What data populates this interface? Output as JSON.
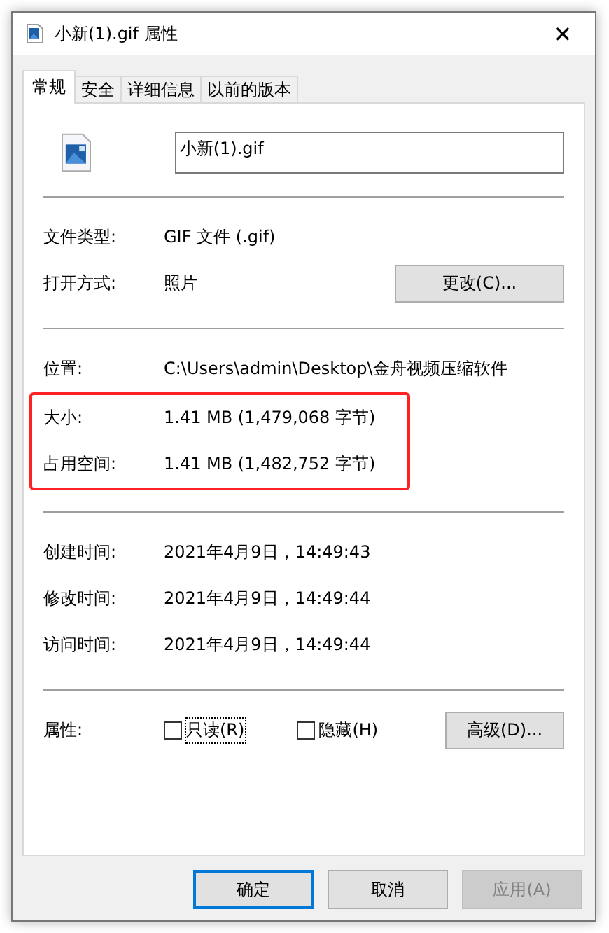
{
  "window": {
    "title": "小新(1).gif 属性",
    "close": "✕"
  },
  "tabs": [
    {
      "label": "常规",
      "selected": true
    },
    {
      "label": "安全",
      "selected": false
    },
    {
      "label": "详细信息",
      "selected": false
    },
    {
      "label": "以前的版本",
      "selected": false
    }
  ],
  "file_name": "小新(1).gif",
  "blocks": [
    {
      "kind": "divider"
    },
    {
      "kind": "row",
      "label": "文件类型:",
      "value": "GIF 文件 (.gif)"
    },
    {
      "kind": "row",
      "label": "打开方式:",
      "value": "照片",
      "button": "更改(C)..."
    },
    {
      "kind": "divider"
    },
    {
      "kind": "row",
      "label": "位置:",
      "value": "C:\\Users\\admin\\Desktop\\金舟视频压缩软件"
    },
    {
      "kind": "highlight",
      "rows": [
        {
          "label": "大小:",
          "value": "1.41 MB (1,479,068 字节)"
        },
        {
          "label": "占用空间:",
          "value": "1.41 MB (1,482,752 字节)"
        }
      ]
    },
    {
      "kind": "divider"
    },
    {
      "kind": "row",
      "label": "创建时间:",
      "value": "2021年4月9日，14:49:43"
    },
    {
      "kind": "row",
      "label": "修改时间:",
      "value": "2021年4月9日，14:49:44"
    },
    {
      "kind": "row",
      "label": "访问时间:",
      "value": "2021年4月9日，14:49:44"
    },
    {
      "kind": "divider"
    },
    {
      "kind": "attributes",
      "label": "属性:",
      "checkboxes": [
        {
          "label": "只读(R)",
          "checked": false,
          "focused": true
        },
        {
          "label": "隐藏(H)",
          "checked": false,
          "focused": false
        }
      ],
      "button": "高级(D)..."
    }
  ],
  "buttons": [
    {
      "label": "确定",
      "default": true,
      "disabled": false
    },
    {
      "label": "取消",
      "default": false,
      "disabled": false
    },
    {
      "label": "应用(A)",
      "default": false,
      "disabled": true
    }
  ]
}
